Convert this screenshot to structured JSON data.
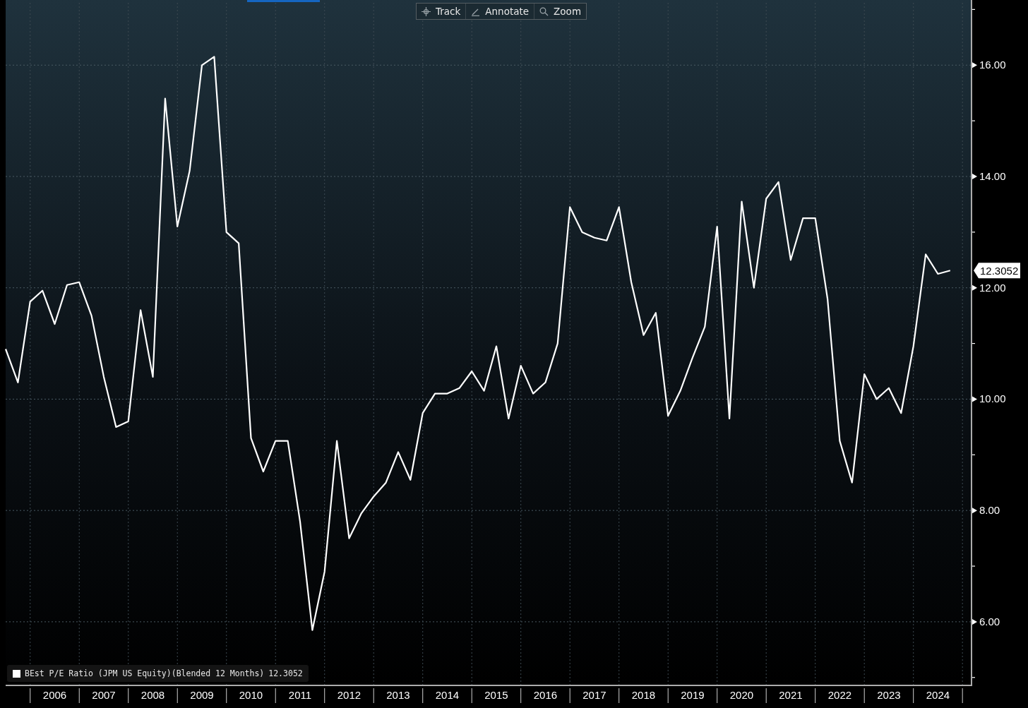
{
  "toolbar": {
    "buttons": [
      {
        "kind": "track",
        "label": "Track"
      },
      {
        "kind": "annotate",
        "label": "Annotate"
      },
      {
        "kind": "zoom",
        "label": "Zoom"
      }
    ]
  },
  "chart": {
    "legend": {
      "value": "12.3052",
      "color": "#ffffff"
    },
    "last_value_label": "12.3052",
    "chart_data": {
      "type": "line",
      "grid": true,
      "x": [
        2005.5,
        2005.75,
        2006,
        2006.25,
        2006.5,
        2006.75,
        2007,
        2007.25,
        2007.5,
        2007.75,
        2008,
        2008.25,
        2008.5,
        2008.75,
        2009,
        2009.25,
        2009.5,
        2009.75,
        2010,
        2010.25,
        2010.5,
        2010.75,
        2011,
        2011.25,
        2011.5,
        2011.75,
        2012,
        2012.25,
        2012.5,
        2012.75,
        2013,
        2013.25,
        2013.5,
        2013.75,
        2014,
        2014.25,
        2014.5,
        2014.75,
        2015,
        2015.25,
        2015.5,
        2015.75,
        2016,
        2016.25,
        2016.5,
        2016.75,
        2017,
        2017.25,
        2017.5,
        2017.75,
        2018,
        2018.25,
        2018.5,
        2018.75,
        2019,
        2019.25,
        2019.5,
        2019.75,
        2020,
        2020.25,
        2020.5,
        2020.75,
        2021,
        2021.25,
        2021.5,
        2021.75,
        2022,
        2022.25,
        2022.5,
        2022.75,
        2023,
        2023.25,
        2023.5,
        2023.75,
        2024,
        2024.25,
        2024.5,
        2024.75
      ],
      "series": [
        {
          "name": "BEst P/E Ratio (JPM US Equity)(Blended 12 Months)",
          "color": "#ffffff",
          "values": [
            10.9,
            10.3,
            11.75,
            11.95,
            11.35,
            12.05,
            12.1,
            11.5,
            10.4,
            9.5,
            9.6,
            11.6,
            10.4,
            15.4,
            13.1,
            14.1,
            16.0,
            16.15,
            13.0,
            12.8,
            9.3,
            8.7,
            9.25,
            9.25,
            7.8,
            5.85,
            6.9,
            9.25,
            7.5,
            7.95,
            8.25,
            8.5,
            9.05,
            8.55,
            9.75,
            10.1,
            10.1,
            10.2,
            10.5,
            10.15,
            10.95,
            9.65,
            10.6,
            10.1,
            10.3,
            11.0,
            13.45,
            13.0,
            12.9,
            12.85,
            13.45,
            12.1,
            11.15,
            11.55,
            9.7,
            10.15,
            10.75,
            11.3,
            13.1,
            9.65,
            13.55,
            12.0,
            13.6,
            13.9,
            12.5,
            13.25,
            13.25,
            11.8,
            9.25,
            8.5,
            10.45,
            10.0,
            10.2,
            9.75,
            10.95,
            12.6,
            12.25,
            12.31
          ]
        }
      ],
      "xlim": [
        2005.5,
        2025.17
      ],
      "ylim": [
        4.87,
        17.17
      ],
      "xticks": [
        {
          "value": 2006.5,
          "label": "2006"
        },
        {
          "value": 2007.5,
          "label": "2007"
        },
        {
          "value": 2008.5,
          "label": "2008"
        },
        {
          "value": 2009.5,
          "label": "2009"
        },
        {
          "value": 2010.5,
          "label": "2010"
        },
        {
          "value": 2011.5,
          "label": "2011"
        },
        {
          "value": 2012.5,
          "label": "2012"
        },
        {
          "value": 2013.5,
          "label": "2013"
        },
        {
          "value": 2014.5,
          "label": "2014"
        },
        {
          "value": 2015.5,
          "label": "2015"
        },
        {
          "value": 2016.5,
          "label": "2016"
        },
        {
          "value": 2017.5,
          "label": "2017"
        },
        {
          "value": 2018.5,
          "label": "2018"
        },
        {
          "value": 2019.5,
          "label": "2019"
        },
        {
          "value": 2020.5,
          "label": "2020"
        },
        {
          "value": 2021.5,
          "label": "2021"
        },
        {
          "value": 2022.5,
          "label": "2022"
        },
        {
          "value": 2023.5,
          "label": "2023"
        },
        {
          "value": 2024.5,
          "label": "2024"
        }
      ],
      "yticks": [
        {
          "value": 6,
          "label": "6.00"
        },
        {
          "value": 8,
          "label": "8.00"
        },
        {
          "value": 10,
          "label": "10.00"
        },
        {
          "value": 12,
          "label": "12.00"
        },
        {
          "value": 14,
          "label": "14.00"
        },
        {
          "value": 16,
          "label": "16.00"
        }
      ]
    }
  }
}
